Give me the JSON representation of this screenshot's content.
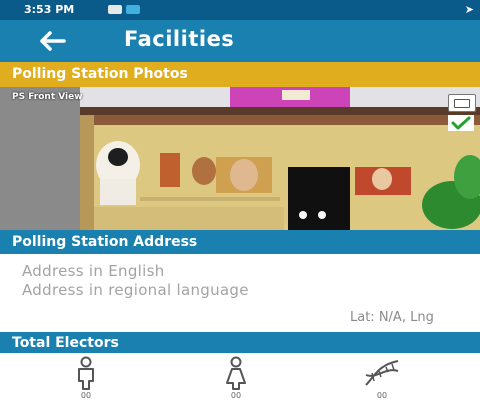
{
  "status_bar": {
    "time": "3:53 PM",
    "notification_icons": [
      "gallery-icon",
      "sim-icon"
    ],
    "network_icon": "location-arrow-icon"
  },
  "app_bar": {
    "back_icon": "back-arrow-icon",
    "title": "Facilities"
  },
  "photos_section": {
    "header": "Polling Station Photos",
    "photo_caption": "PS Front View",
    "photo_actions": [
      "camera-icon",
      "check-icon"
    ]
  },
  "address_section": {
    "header": "Polling Station Address",
    "address_english_placeholder": "Address in English",
    "address_regional_placeholder": "Address in regional language",
    "coordinates": "Lat: N/A, Lng"
  },
  "electors_section": {
    "header": "Total Electors",
    "categories": [
      {
        "icon": "male-icon",
        "count": "00"
      },
      {
        "icon": "female-icon",
        "count": "00"
      },
      {
        "icon": "third-gender-dna-icon",
        "count": "00"
      }
    ]
  },
  "colors": {
    "status_bar": "#0a5a8a",
    "primary": "#1a80b0",
    "accent_yellow": "#e0ad1e",
    "placeholder_text": "#a3a3a3"
  }
}
